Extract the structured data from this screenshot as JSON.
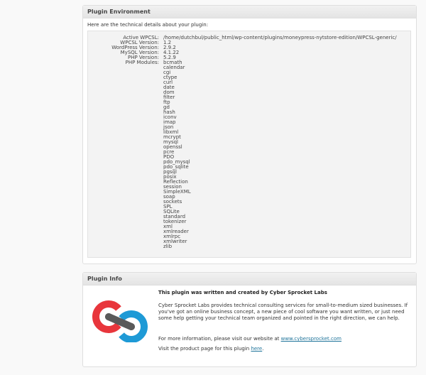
{
  "environment": {
    "title": "Plugin Environment",
    "intro": "Here are the technical details about your plugin:",
    "rows": [
      {
        "label": "Active WPCSL:",
        "value": "/home/dutchbul/public_html/wp-content/plugins/moneypress-nytstore-edition/WPCSL-generic/"
      },
      {
        "label": "WPCSL Version:",
        "value": "1.2"
      },
      {
        "label": "WordPress Version:",
        "value": "2.9.2"
      },
      {
        "label": "MySQL Version:",
        "value": "4.1.22"
      },
      {
        "label": "PHP Version:",
        "value": "5.2.9"
      },
      {
        "label": "PHP Modules:",
        "value": "bcmath"
      }
    ],
    "modules": [
      "calendar",
      "cgi",
      "ctype",
      "curl",
      "date",
      "dom",
      "filter",
      "ftp",
      "gd",
      "hash",
      "iconv",
      "imap",
      "json",
      "libxml",
      "mcrypt",
      "mysql",
      "openssl",
      "pcre",
      "PDO",
      "pdo_mysql",
      "pdo_sqlite",
      "pgsql",
      "posix",
      "Reflection",
      "session",
      "SimpleXML",
      "soap",
      "sockets",
      "SPL",
      "SQLite",
      "standard",
      "tokenizer",
      "xml",
      "xmlreader",
      "xmlrpc",
      "xmlwriter",
      "zlib"
    ]
  },
  "info": {
    "title": "Plugin Info",
    "heading": "This plugin was written and created by Cyber Sprocket Labs",
    "paragraph1": "Cyber Sprocket Labs provides technical consulting services for small-to-medium sized businesses. If you've got an online business concept, a new piece of cool software you want written, or just need some help getting your technical team organized and pointed in the right direction, we can help.",
    "paragraph2_text": "For more information, please visit our website at ",
    "website_link": "www.cybersprocket.com",
    "paragraph3_text": "Visit the product page for this plugin ",
    "product_link": "here",
    "period": "."
  },
  "colors": {
    "logo_red": "#e8363c",
    "logo_blue": "#1e9ad6",
    "logo_dark": "#5a5a5a"
  },
  "icons": {
    "logo": "cyber-sprocket-logo"
  }
}
